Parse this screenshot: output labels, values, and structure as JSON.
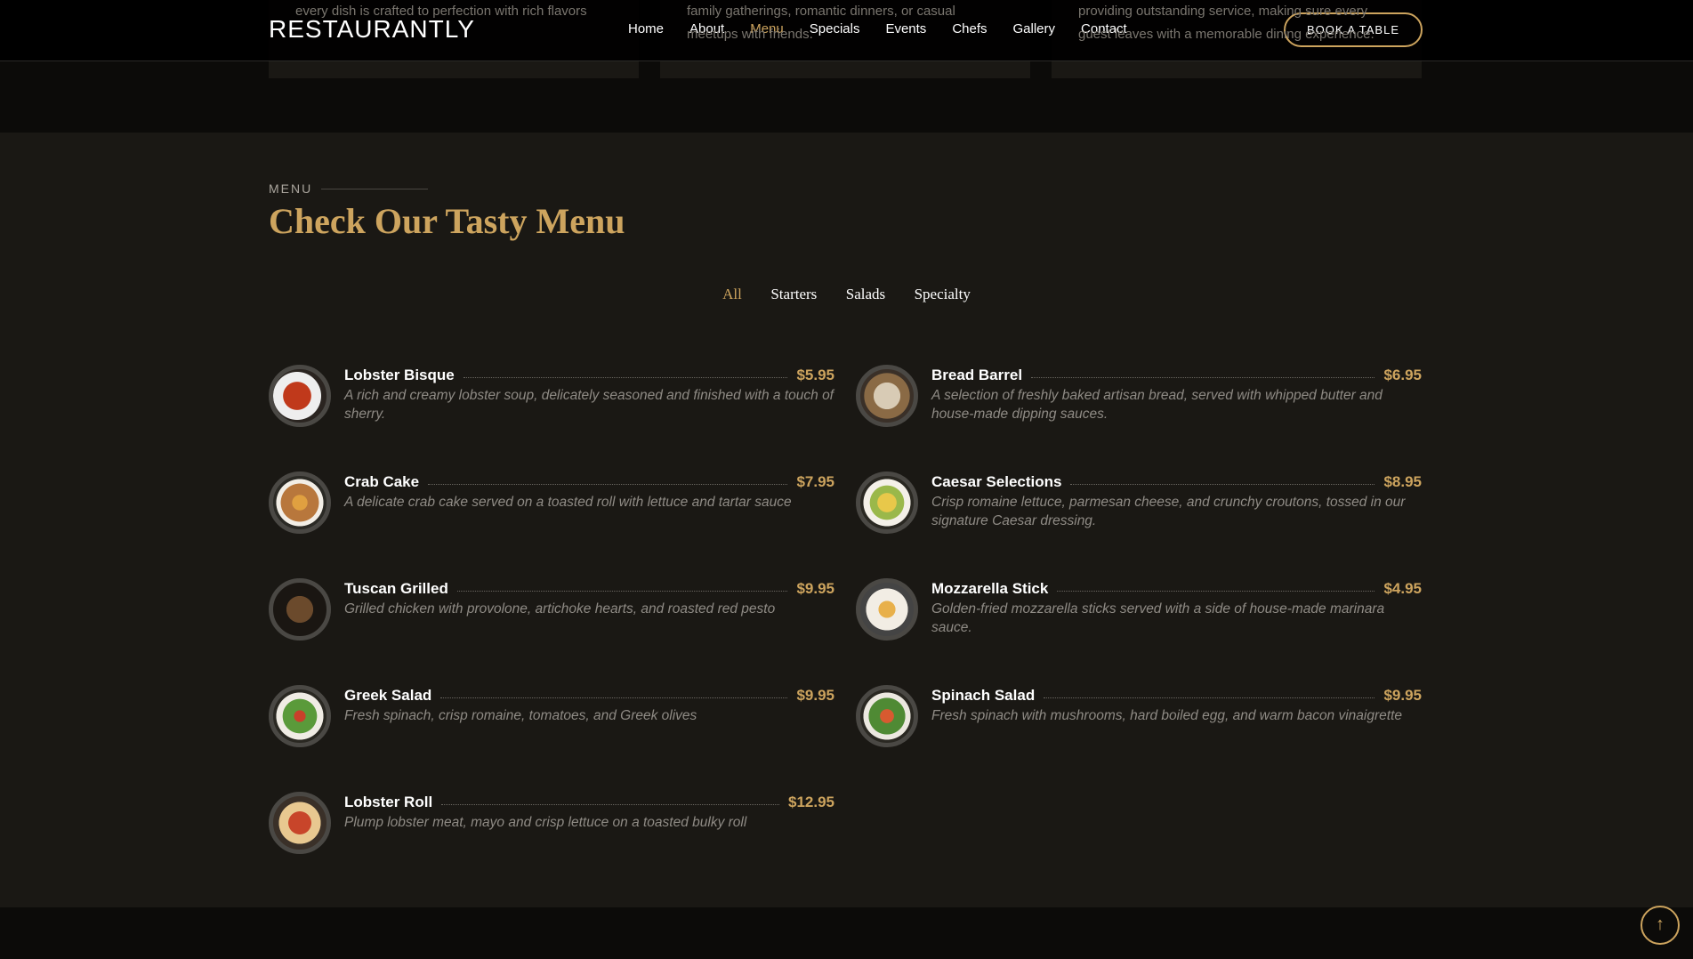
{
  "header": {
    "logo": "RESTAURANTLY",
    "nav": [
      "Home",
      "About",
      "Menu",
      "Specials",
      "Events",
      "Chefs",
      "Gallery",
      "Contact"
    ],
    "active": "Menu",
    "book_label": "BOOK A TABLE"
  },
  "behind_cards": [
    "every dish is crafted to perfection with rich flavors",
    "family gatherings, romantic dinners, or casual meetups with friends.",
    "providing outstanding service, making sure every guest leaves with a memorable dining experience."
  ],
  "menu": {
    "label": "MENU",
    "title": "Check Our Tasty Menu",
    "filters": [
      "All",
      "Starters",
      "Salads",
      "Specialty"
    ],
    "active_filter": "All",
    "items": [
      {
        "name": "Lobster Bisque",
        "price": "$5.95",
        "desc": "A rich and creamy lobster soup, delicately seasoned and finished with a touch of sherry."
      },
      {
        "name": "Bread Barrel",
        "price": "$6.95",
        "desc": "A selection of freshly baked artisan bread, served with whipped butter and house-made dipping sauces."
      },
      {
        "name": "Crab Cake",
        "price": "$7.95",
        "desc": "A delicate crab cake served on a toasted roll with lettuce and tartar sauce"
      },
      {
        "name": "Caesar Selections",
        "price": "$8.95",
        "desc": "Crisp romaine lettuce, parmesan cheese, and crunchy croutons, tossed in our signature Caesar dressing."
      },
      {
        "name": "Tuscan Grilled",
        "price": "$9.95",
        "desc": "Grilled chicken with provolone, artichoke hearts, and roasted red pesto"
      },
      {
        "name": "Mozzarella Stick",
        "price": "$4.95",
        "desc": "Golden-fried mozzarella sticks served with a side of house-made marinara sauce."
      },
      {
        "name": "Greek Salad",
        "price": "$9.95",
        "desc": "Fresh spinach, crisp romaine, tomatoes, and Greek olives"
      },
      {
        "name": "Spinach Salad",
        "price": "$9.95",
        "desc": "Fresh spinach with mushrooms, hard boiled egg, and warm bacon vinaigrette"
      },
      {
        "name": "Lobster Roll",
        "price": "$12.95",
        "desc": "Plump lobster meat, mayo and crisp lettuce on a toasted bulky roll"
      }
    ]
  },
  "colors": {
    "accent": "#cda45e",
    "bg": "#1a1814"
  },
  "icons": {
    "scroll_top": "arrow-up-icon"
  }
}
